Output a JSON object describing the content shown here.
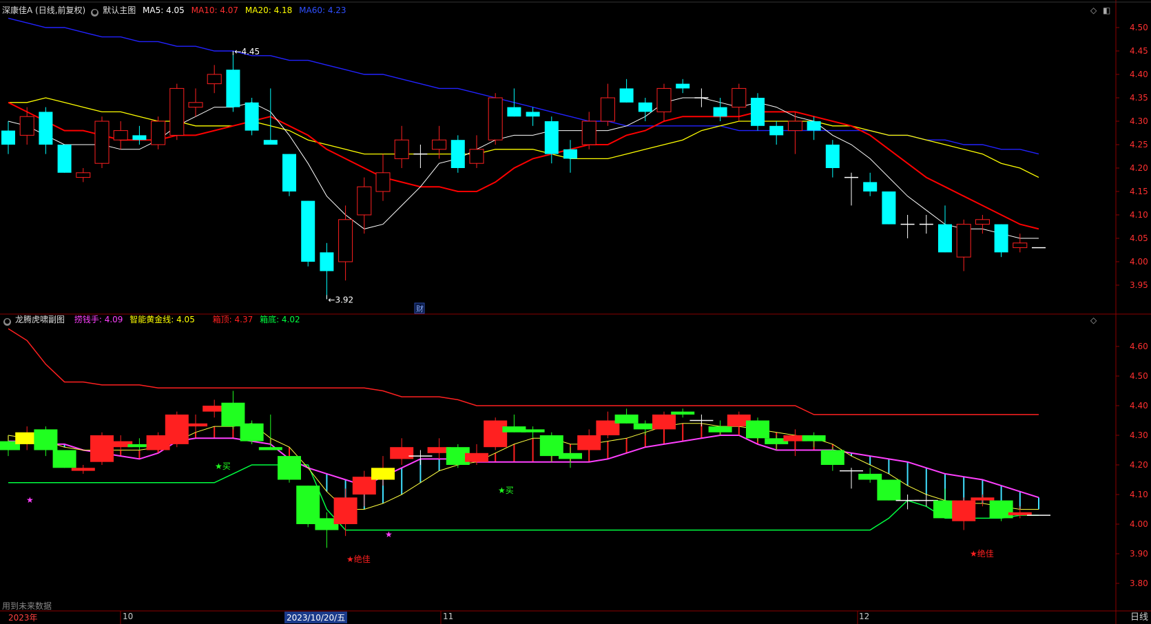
{
  "header_main": {
    "stock": "深康佳A (日线,前复权)",
    "indicator": "默认主图",
    "ma5": "MA5: 4.05",
    "ma10": "MA10: 4.07",
    "ma20": "MA20: 4.18",
    "ma60": "MA60: 4.23"
  },
  "header_sub": {
    "indicator": "龙腾虎啸副图",
    "lao": "捞钱手: 4.09",
    "gold": "智能黄金线: 4.05",
    "top": "箱顶: 4.37",
    "bottom": "箱底: 4.02"
  },
  "status_text": "用到未来数据",
  "period_label": "日线",
  "time_axis": [
    "2023年",
    "10",
    "2023/10/20/五",
    "11",
    "12"
  ],
  "colors": {
    "up": "#ff2020",
    "down": "#00ffff",
    "ma5": "#ffffff",
    "ma10": "#ff0000",
    "ma20": "#ffff00",
    "ma60": "#2222ff",
    "grid": "#8b0000"
  },
  "chart_data": {
    "type": "candlestick",
    "price_axis_main": {
      "ticks": [
        "4.50",
        "4.45",
        "4.40",
        "4.35",
        "4.30",
        "4.25",
        "4.20",
        "4.15",
        "4.10",
        "4.05",
        "4.00",
        "3.95"
      ],
      "ylim": [
        3.93,
        4.52
      ]
    },
    "price_axis_sub": {
      "ticks": [
        "4.60",
        "4.50",
        "4.40",
        "4.30",
        "4.20",
        "4.10",
        "4.00",
        "3.90",
        "3.80"
      ],
      "ylim": [
        3.73,
        4.67
      ]
    },
    "annotations": {
      "high": "4.45",
      "low": "3.92",
      "cai": "财",
      "buy": "★买",
      "jue": "★绝佳",
      "star": "★"
    },
    "candles": [
      [
        4.28,
        4.25,
        4.3,
        4.23
      ],
      [
        4.27,
        4.31,
        4.33,
        4.25
      ],
      [
        4.32,
        4.25,
        4.33,
        4.23
      ],
      [
        4.25,
        4.19,
        4.25,
        4.19
      ],
      [
        4.18,
        4.19,
        4.2,
        4.17
      ],
      [
        4.21,
        4.3,
        4.31,
        4.2
      ],
      [
        4.26,
        4.28,
        4.3,
        4.24
      ],
      [
        4.27,
        4.26,
        4.29,
        4.25
      ],
      [
        4.25,
        4.3,
        4.31,
        4.24
      ],
      [
        4.27,
        4.37,
        4.38,
        4.26
      ],
      [
        4.33,
        4.34,
        4.37,
        4.31
      ],
      [
        4.38,
        4.4,
        4.42,
        4.36
      ],
      [
        4.41,
        4.33,
        4.45,
        4.32
      ],
      [
        4.34,
        4.28,
        4.35,
        4.27
      ],
      [
        4.26,
        4.25,
        4.37,
        4.25
      ],
      [
        4.23,
        4.15,
        4.23,
        4.14
      ],
      [
        4.13,
        4.0,
        4.13,
        3.99
      ],
      [
        4.02,
        3.98,
        4.04,
        3.92
      ],
      [
        4.0,
        4.09,
        4.12,
        3.96
      ],
      [
        4.1,
        4.16,
        4.18,
        4.06
      ],
      [
        4.15,
        4.19,
        4.23,
        4.13
      ],
      [
        4.22,
        4.26,
        4.29,
        4.2
      ],
      [
        4.23,
        4.23,
        4.25,
        4.2
      ],
      [
        4.24,
        4.26,
        4.29,
        4.22
      ],
      [
        4.26,
        4.2,
        4.27,
        4.19
      ],
      [
        4.21,
        4.24,
        4.27,
        4.2
      ],
      [
        4.26,
        4.35,
        4.36,
        4.25
      ],
      [
        4.33,
        4.31,
        4.37,
        4.31
      ],
      [
        4.32,
        4.31,
        4.33,
        4.29
      ],
      [
        4.3,
        4.23,
        4.31,
        4.21
      ],
      [
        4.24,
        4.22,
        4.26,
        4.19
      ],
      [
        4.25,
        4.3,
        4.32,
        4.24
      ],
      [
        4.3,
        4.35,
        4.38,
        4.29
      ],
      [
        4.37,
        4.34,
        4.39,
        4.34
      ],
      [
        4.34,
        4.32,
        4.35,
        4.3
      ],
      [
        4.32,
        4.37,
        4.38,
        4.3
      ],
      [
        4.38,
        4.37,
        4.39,
        4.36
      ],
      [
        4.35,
        4.35,
        4.37,
        4.33
      ],
      [
        4.33,
        4.31,
        4.35,
        4.3
      ],
      [
        4.33,
        4.37,
        4.38,
        4.3
      ],
      [
        4.35,
        4.29,
        4.36,
        4.28
      ],
      [
        4.29,
        4.27,
        4.3,
        4.25
      ],
      [
        4.28,
        4.3,
        4.32,
        4.23
      ],
      [
        4.3,
        4.28,
        4.31,
        4.26
      ],
      [
        4.25,
        4.2,
        4.26,
        4.18
      ],
      [
        4.18,
        4.18,
        4.19,
        4.12
      ],
      [
        4.17,
        4.15,
        4.19,
        4.14
      ],
      [
        4.15,
        4.08,
        4.15,
        4.08
      ],
      [
        4.08,
        4.08,
        4.1,
        4.05
      ],
      [
        4.08,
        4.08,
        4.1,
        4.06
      ],
      [
        4.08,
        4.02,
        4.12,
        4.02
      ],
      [
        4.01,
        4.08,
        4.09,
        3.98
      ],
      [
        4.08,
        4.09,
        4.1,
        4.06
      ],
      [
        4.08,
        4.02,
        4.08,
        4.01
      ],
      [
        4.03,
        4.04,
        4.06,
        4.02
      ],
      [
        4.03,
        4.03,
        4.03,
        4.03
      ]
    ],
    "ma5": [
      4.3,
      4.29,
      4.27,
      4.25,
      4.25,
      4.25,
      4.24,
      4.24,
      4.26,
      4.29,
      4.31,
      4.33,
      4.33,
      4.34,
      4.32,
      4.27,
      4.21,
      4.14,
      4.1,
      4.07,
      4.08,
      4.12,
      4.16,
      4.21,
      4.22,
      4.24,
      4.26,
      4.27,
      4.27,
      4.28,
      4.28,
      4.28,
      4.28,
      4.29,
      4.31,
      4.34,
      4.35,
      4.35,
      4.34,
      4.33,
      4.34,
      4.33,
      4.31,
      4.3,
      4.27,
      4.25,
      4.22,
      4.18,
      4.14,
      4.11,
      4.08,
      4.07,
      4.07,
      4.06,
      4.05,
      4.05
    ],
    "ma10": [
      4.34,
      4.32,
      4.3,
      4.28,
      4.28,
      4.27,
      4.26,
      4.26,
      4.26,
      4.27,
      4.27,
      4.28,
      4.29,
      4.3,
      4.31,
      4.29,
      4.27,
      4.24,
      4.22,
      4.2,
      4.18,
      4.17,
      4.16,
      4.16,
      4.15,
      4.15,
      4.17,
      4.2,
      4.22,
      4.23,
      4.24,
      4.25,
      4.25,
      4.27,
      4.28,
      4.3,
      4.31,
      4.31,
      4.31,
      4.31,
      4.32,
      4.32,
      4.32,
      4.31,
      4.3,
      4.29,
      4.27,
      4.24,
      4.21,
      4.18,
      4.16,
      4.14,
      4.12,
      4.1,
      4.08,
      4.07
    ],
    "ma20": [
      4.34,
      4.34,
      4.35,
      4.34,
      4.33,
      4.32,
      4.32,
      4.31,
      4.3,
      4.3,
      4.29,
      4.29,
      4.29,
      4.3,
      4.29,
      4.28,
      4.26,
      4.25,
      4.24,
      4.23,
      4.23,
      4.23,
      4.23,
      4.23,
      4.23,
      4.23,
      4.24,
      4.24,
      4.24,
      4.23,
      4.22,
      4.22,
      4.22,
      4.23,
      4.24,
      4.25,
      4.26,
      4.28,
      4.29,
      4.3,
      4.3,
      4.3,
      4.3,
      4.3,
      4.29,
      4.29,
      4.28,
      4.27,
      4.27,
      4.26,
      4.25,
      4.24,
      4.23,
      4.21,
      4.2,
      4.18
    ],
    "ma60": [
      4.52,
      4.51,
      4.5,
      4.5,
      4.49,
      4.48,
      4.48,
      4.47,
      4.47,
      4.46,
      4.46,
      4.45,
      4.45,
      4.44,
      4.44,
      4.43,
      4.43,
      4.42,
      4.41,
      4.4,
      4.4,
      4.39,
      4.38,
      4.37,
      4.37,
      4.36,
      4.35,
      4.34,
      4.33,
      4.32,
      4.31,
      4.3,
      4.3,
      4.29,
      4.29,
      4.29,
      4.29,
      4.29,
      4.29,
      4.28,
      4.28,
      4.28,
      4.28,
      4.28,
      4.28,
      4.28,
      4.28,
      4.27,
      4.27,
      4.26,
      4.26,
      4.25,
      4.25,
      4.24,
      4.24,
      4.23
    ],
    "box_top": [
      4.66,
      4.62,
      4.54,
      4.48,
      4.48,
      4.47,
      4.47,
      4.47,
      4.46,
      4.46,
      4.46,
      4.46,
      4.46,
      4.46,
      4.46,
      4.46,
      4.46,
      4.46,
      4.46,
      4.46,
      4.45,
      4.43,
      4.43,
      4.43,
      4.42,
      4.4,
      4.4,
      4.4,
      4.4,
      4.4,
      4.4,
      4.4,
      4.4,
      4.4,
      4.4,
      4.4,
      4.4,
      4.4,
      4.4,
      4.4,
      4.4,
      4.4,
      4.4,
      4.37,
      4.37,
      4.37,
      4.37,
      4.37,
      4.37,
      4.37,
      4.37,
      4.37,
      4.37,
      4.37,
      4.37,
      4.37
    ],
    "box_bottom": [
      4.14,
      4.14,
      4.14,
      4.14,
      4.14,
      4.14,
      4.14,
      4.14,
      4.14,
      4.14,
      4.14,
      4.14,
      4.17,
      4.2,
      4.2,
      4.2,
      4.2,
      4.05,
      3.98,
      3.98,
      3.98,
      3.98,
      3.98,
      3.98,
      3.98,
      3.98,
      3.98,
      3.98,
      3.98,
      3.98,
      3.98,
      3.98,
      3.98,
      3.98,
      3.98,
      3.98,
      3.98,
      3.98,
      3.98,
      3.98,
      3.98,
      3.98,
      3.98,
      3.98,
      3.98,
      3.98,
      3.98,
      4.02,
      4.08,
      4.06,
      4.02,
      4.02,
      4.02,
      4.02,
      4.03,
      4.03
    ],
    "lao_line": [
      4.28,
      4.28,
      4.27,
      4.27,
      4.25,
      4.24,
      4.23,
      4.22,
      4.24,
      4.28,
      4.29,
      4.29,
      4.29,
      4.28,
      4.27,
      4.22,
      4.19,
      4.17,
      4.15,
      4.13,
      4.16,
      4.19,
      4.22,
      4.22,
      4.22,
      4.21,
      4.21,
      4.21,
      4.21,
      4.21,
      4.21,
      4.21,
      4.22,
      4.24,
      4.26,
      4.27,
      4.28,
      4.29,
      4.3,
      4.3,
      4.27,
      4.25,
      4.25,
      4.25,
      4.25,
      4.24,
      4.23,
      4.22,
      4.21,
      4.19,
      4.17,
      4.16,
      4.15,
      4.13,
      4.11,
      4.09
    ],
    "gold_line": [
      4.3,
      4.29,
      4.28,
      4.26,
      4.25,
      4.25,
      4.25,
      4.25,
      4.26,
      4.28,
      4.31,
      4.33,
      4.33,
      4.34,
      4.29,
      4.26,
      4.19,
      4.11,
      4.05,
      4.05,
      4.07,
      4.1,
      4.14,
      4.18,
      4.2,
      4.21,
      4.24,
      4.27,
      4.29,
      4.29,
      4.27,
      4.27,
      4.28,
      4.29,
      4.31,
      4.33,
      4.34,
      4.34,
      4.33,
      4.33,
      4.32,
      4.31,
      4.3,
      4.29,
      4.27,
      4.23,
      4.2,
      4.17,
      4.13,
      4.1,
      4.08,
      4.07,
      4.07,
      4.06,
      4.05,
      4.05
    ]
  }
}
